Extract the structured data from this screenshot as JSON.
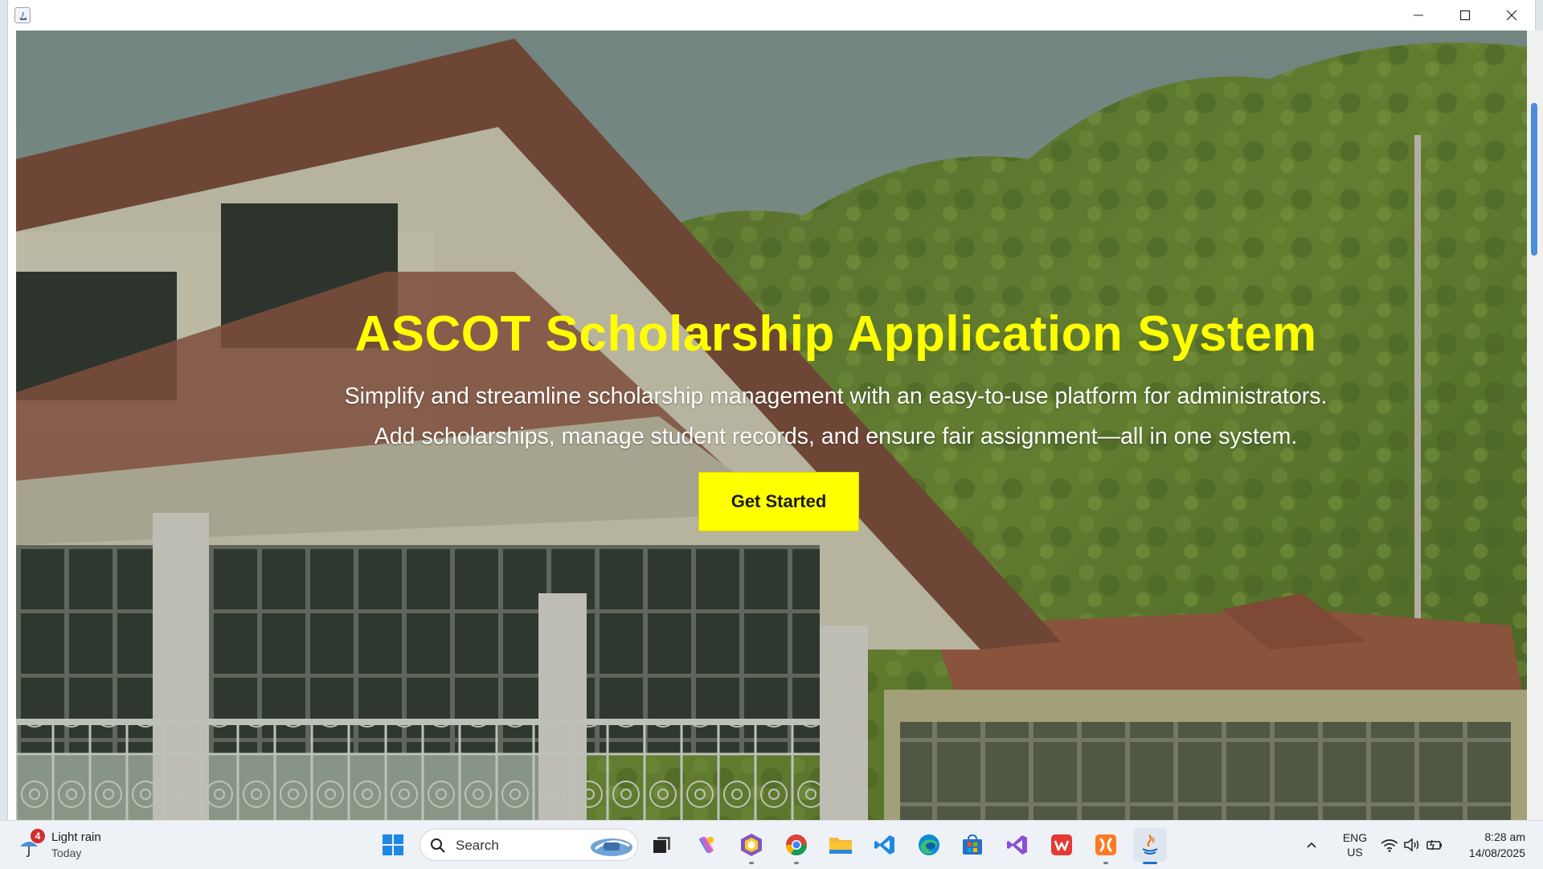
{
  "window": {
    "controls": {
      "minimize": "minimize",
      "maximize": "maximize",
      "close": "close"
    }
  },
  "hero": {
    "title": "ASCOT Scholarship Application System",
    "subtitle_line1": "Simplify and streamline scholarship management with an easy-to-use platform for administrators.",
    "subtitle_line2": "Add scholarships, manage student records, and ensure fair assignment—all in one system.",
    "cta_label": "Get Started"
  },
  "colors": {
    "accent": "#ffff00",
    "text_light": "#ffffff",
    "taskbar": "#eef1f5"
  },
  "taskbar": {
    "weather": {
      "badge": "4",
      "title": "Light rain",
      "subtitle": "Today"
    },
    "search": {
      "placeholder": "Search"
    },
    "apps": [
      {
        "name": "start",
        "icon": "windows-icon"
      },
      {
        "name": "task-view",
        "icon": "task-view-icon"
      },
      {
        "name": "copilot",
        "icon": "copilot-icon"
      },
      {
        "name": "app-hexagon",
        "icon": "hexagon-app-icon"
      },
      {
        "name": "chrome",
        "icon": "chrome-icon"
      },
      {
        "name": "file-explorer",
        "icon": "folder-icon"
      },
      {
        "name": "vscode",
        "icon": "vscode-icon"
      },
      {
        "name": "edge",
        "icon": "edge-icon"
      },
      {
        "name": "store",
        "icon": "store-icon"
      },
      {
        "name": "visual-studio",
        "icon": "visual-studio-icon"
      },
      {
        "name": "wps",
        "icon": "wps-icon"
      },
      {
        "name": "xampp",
        "icon": "xampp-icon"
      },
      {
        "name": "java",
        "icon": "java-icon"
      }
    ],
    "tray": {
      "language": "ENG",
      "region": "US",
      "time": "8:28 am",
      "date": "14/08/2025"
    }
  }
}
